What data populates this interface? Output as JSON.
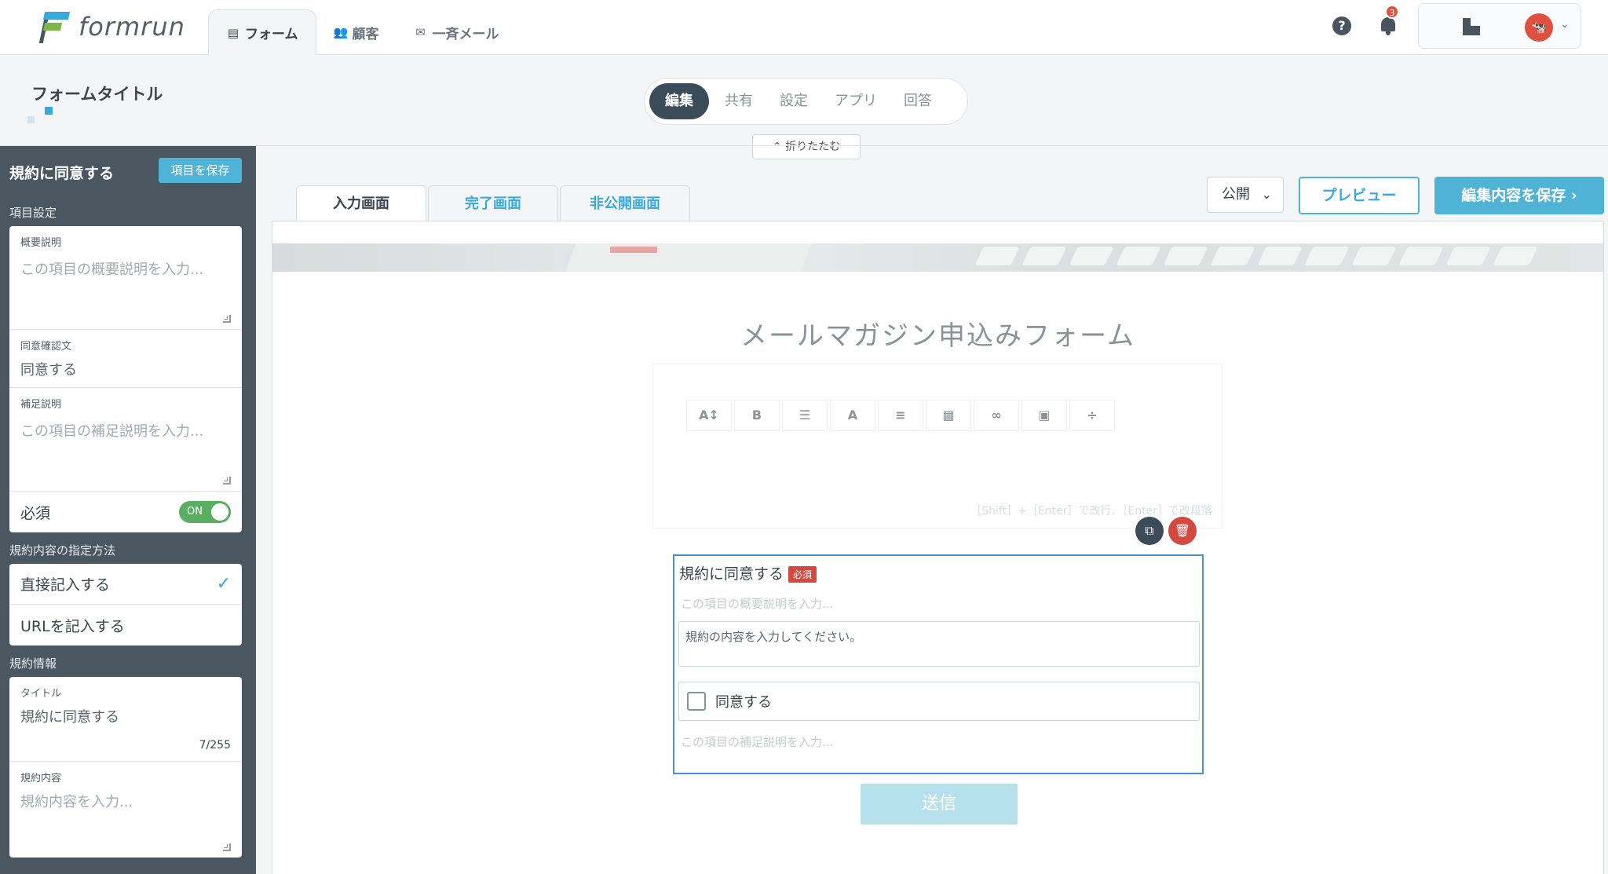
{
  "app": {
    "logo_text": "formrun"
  },
  "nav": {
    "tabs": [
      {
        "label": "フォーム",
        "icon": "form-icon"
      },
      {
        "label": "顧客",
        "icon": "people-icon"
      },
      {
        "label": "一斉メール",
        "icon": "mail-icon"
      }
    ],
    "notification_count": "3",
    "help_glyph": "?"
  },
  "header": {
    "form_title": "フォームタイトル",
    "modes": [
      "編集",
      "共有",
      "設定",
      "アプリ",
      "回答"
    ],
    "active_mode": "編集",
    "collapse_label": "折りたたむ"
  },
  "sidebar": {
    "title": "規約に同意する",
    "save_label": "項目を保存",
    "item_settings_label": "項目設定",
    "summary_label": "概要説明",
    "summary_placeholder": "この項目の概要説明を入力...",
    "confirm_label": "同意確認文",
    "confirm_value": "同意する",
    "supplement_label": "補足説明",
    "supplement_placeholder": "この項目の補足説明を入力...",
    "required_label": "必須",
    "toggle_label": "ON",
    "method_section": "規約内容の指定方法",
    "method_options": [
      "直接記入する",
      "URLを記入する"
    ],
    "selected_method": "直接記入する",
    "info_section": "規約情報",
    "title_label": "タイトル",
    "title_value": "規約に同意する",
    "title_counter": "7/255",
    "content_label": "規約内容",
    "content_placeholder": "規約内容を入力..."
  },
  "content": {
    "screen_tabs": [
      "入力画面",
      "完了画面",
      "非公開画面"
    ],
    "active_screen": "入力画面",
    "publish_value": "公開",
    "preview_label": "プレビュー",
    "save_label": "編集内容を保存",
    "form_heading": "メールマガジン申込みフォーム",
    "editor_hint": "［Shift］+［Enter］で改行、［Enter］で改段落",
    "toolbar_icons": [
      "font-size-icon",
      "bold-icon",
      "list-icon",
      "text-color-icon",
      "align-icon",
      "table-icon",
      "link-icon",
      "image-icon",
      "divider-icon"
    ],
    "toolbar_glyphs": [
      "A↕",
      "B",
      "☰",
      "A",
      "≡",
      "▦",
      "∞",
      "▣",
      "÷"
    ],
    "field": {
      "title": "規約に同意する",
      "required_badge": "必須",
      "summary_placeholder": "この項目の概要説明を入力...",
      "terms_placeholder": "規約の内容を入力してください。",
      "agree_label": "同意する",
      "supplement_placeholder": "この項目の補足説明を入力..."
    },
    "submit_label": "送信"
  },
  "colors": {
    "accent": "#4fb3d6",
    "sidebar_bg": "#4a5660",
    "danger": "#d4493e",
    "toggle_on": "#5aae62"
  }
}
